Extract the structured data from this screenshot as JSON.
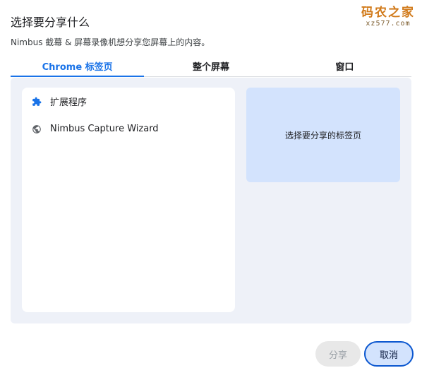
{
  "dialog": {
    "title": "选择要分享什么",
    "subtitle": "Nimbus 截幕 & 屏幕录像机想分享您屏幕上的内容。"
  },
  "watermark": {
    "main": "码农之家",
    "sub": "xz577.com"
  },
  "tabs": [
    {
      "label": "Chrome 标签页",
      "active": true
    },
    {
      "label": "整个屏幕",
      "active": false
    },
    {
      "label": "窗口",
      "active": false
    }
  ],
  "list": {
    "items": [
      {
        "label": "扩展程序",
        "icon": "puzzle-icon"
      },
      {
        "label": "Nimbus Capture Wizard",
        "icon": "globe-icon"
      }
    ]
  },
  "preview": {
    "text": "选择要分享的标签页"
  },
  "buttons": {
    "share_label": "分享",
    "cancel_label": "取消"
  },
  "colors": {
    "accent": "#1a73e8",
    "panel_bg": "#eef1f8",
    "preview_bg": "#d3e3fd"
  }
}
